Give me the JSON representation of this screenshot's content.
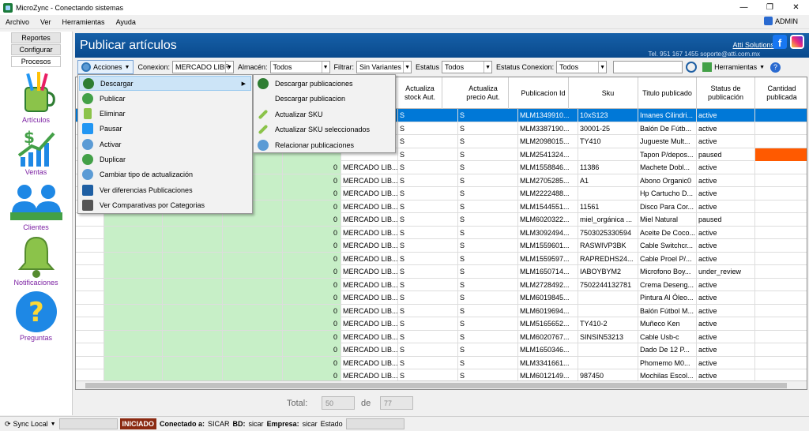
{
  "window": {
    "title": "MicroZync - Conectando sistemas"
  },
  "menubar": {
    "items": [
      "Archivo",
      "Ver",
      "Herramientas",
      "Ayuda"
    ],
    "user": "ADMIN"
  },
  "sidebar": {
    "tabs": [
      "Reportes",
      "Configurar",
      "Procesos"
    ],
    "items": [
      {
        "label": "Artículos",
        "icon": "articles-icon"
      },
      {
        "label": "Ventas",
        "icon": "sales-chart-icon"
      },
      {
        "label": "Clientes",
        "icon": "clients-icon"
      },
      {
        "label": "Notificaciones",
        "icon": "bell-icon"
      },
      {
        "label": "Preguntas",
        "icon": "question-icon"
      }
    ]
  },
  "header": {
    "title": "Publicar artículos",
    "company": "Atti Solutions",
    "contact": "Tel. 951 167 1455 soporte@atti.com.mx"
  },
  "toolbar": {
    "acciones": "Acciones",
    "conexion_label": "Conexion:",
    "conexion_value": "MERCADO LIBR",
    "almacen_label": "Almacén:",
    "almacen_value": "Todos",
    "filtrar_label": "Filtrar:",
    "filtrar_value": "Sin Variantes",
    "estatus_label": "Estatus",
    "estatus_value": "Todos",
    "estatus_conexion_label": "Estatus Conexion:",
    "estatus_conexion_value": "Todos",
    "herramientas": "Herramientas"
  },
  "menu": {
    "items": [
      "Descargar",
      "Publicar",
      "Eliminar",
      "Pausar",
      "Activar",
      "Duplicar",
      "Cambiar tipo de actualización",
      "Ver diferencias Publicaciones",
      "Ver Comparativas por Categorias"
    ],
    "submenu": [
      "Descargar publicaciones",
      "Descargar publicacion",
      "Actualizar SKU",
      "Actualizar SKU seleccionados",
      "Relacionar publicaciones"
    ]
  },
  "table": {
    "headers": [
      "Actualiza stock Aut.",
      "Actualiza precio Aut.",
      "Publicacion Id",
      "Sku",
      "Titulo publicado",
      "Status de publicación",
      "Cantidad publicada"
    ],
    "rows": [
      {
        "n": "",
        "conn": "",
        "s1": "S",
        "s2": "S",
        "id": "MLM1349910...",
        "sku": "10xS123",
        "title": "Imanes Cilindri...",
        "status": "active"
      },
      {
        "n": "",
        "conn": "",
        "s1": "S",
        "s2": "S",
        "id": "MLM3387190...",
        "sku": "30001-25",
        "title": "Balón De Fútb...",
        "status": "active"
      },
      {
        "n": "",
        "conn": "",
        "s1": "S",
        "s2": "S",
        "id": "MLM2098015...",
        "sku": "TY410",
        "title": "Jugueste Mult...",
        "status": "active"
      },
      {
        "n": "",
        "conn": "",
        "s1": "S",
        "s2": "S",
        "id": "MLM2541324...",
        "sku": "",
        "title": "Tapon P/depos...",
        "status": "paused"
      },
      {
        "n": "0",
        "conn": "MERCADO LIB...",
        "s1": "S",
        "s2": "S",
        "id": "MLM1558846...",
        "sku": "11386",
        "title": "Machete Dobl...",
        "status": "active"
      },
      {
        "n": "0",
        "conn": "MERCADO LIB...",
        "s1": "S",
        "s2": "S",
        "id": "MLM2705285...",
        "sku": "A1",
        "title": "Abono Organic0",
        "status": "active"
      },
      {
        "n": "0",
        "conn": "MERCADO LIB...",
        "s1": "S",
        "s2": "S",
        "id": "MLM2222488...",
        "sku": "",
        "title": "Hp Cartucho D...",
        "status": "active"
      },
      {
        "n": "0",
        "conn": "MERCADO LIB...",
        "s1": "S",
        "s2": "S",
        "id": "MLM1544551...",
        "sku": "11561",
        "title": "Disco Para Cor...",
        "status": "active"
      },
      {
        "n": "0",
        "conn": "MERCADO LIB...",
        "s1": "S",
        "s2": "S",
        "id": "MLM6020322...",
        "sku": "miel_orgánica ...",
        "title": "Miel Natural",
        "status": "paused"
      },
      {
        "n": "0",
        "conn": "MERCADO LIB...",
        "s1": "S",
        "s2": "S",
        "id": "MLM3092494...",
        "sku": "7503025330594",
        "title": "Aceite De Coco...",
        "status": "active"
      },
      {
        "n": "0",
        "conn": "MERCADO LIB...",
        "s1": "S",
        "s2": "S",
        "id": "MLM1559601...",
        "sku": "RASWIVP3BK",
        "title": "Cable Switchcr...",
        "status": "active"
      },
      {
        "n": "0",
        "conn": "MERCADO LIB...",
        "s1": "S",
        "s2": "S",
        "id": "MLM1559597...",
        "sku": "RAPREDHS24...",
        "title": "Cable Proel P/...",
        "status": "active"
      },
      {
        "n": "0",
        "conn": "MERCADO LIB...",
        "s1": "S",
        "s2": "S",
        "id": "MLM1650714...",
        "sku": "IABOYBYM2",
        "title": "Microfono Boy...",
        "status": "under_review"
      },
      {
        "n": "0",
        "conn": "MERCADO LIB...",
        "s1": "S",
        "s2": "S",
        "id": "MLM2728492...",
        "sku": "7502244132781",
        "title": "Crema Deseng...",
        "status": "active"
      },
      {
        "n": "0",
        "conn": "MERCADO LIB...",
        "s1": "S",
        "s2": "S",
        "id": "MLM6019845...",
        "sku": "",
        "title": "Pintura Al Óleo...",
        "status": "active"
      },
      {
        "n": "0",
        "conn": "MERCADO LIB...",
        "s1": "S",
        "s2": "S",
        "id": "MLM6019694...",
        "sku": "",
        "title": "Balón Fútbol M...",
        "status": "active"
      },
      {
        "n": "0",
        "conn": "MERCADO LIB...",
        "s1": "S",
        "s2": "S",
        "id": "MLM5165652...",
        "sku": "TY410-2",
        "title": "Muñeco Ken",
        "status": "active"
      },
      {
        "n": "0",
        "conn": "MERCADO LIB...",
        "s1": "S",
        "s2": "S",
        "id": "MLM6020767...",
        "sku": "SINSIN53213",
        "title": "Cable Usb-c",
        "status": "active"
      },
      {
        "n": "0",
        "conn": "MERCADO LIB...",
        "s1": "S",
        "s2": "S",
        "id": "MLM1650346...",
        "sku": "",
        "title": "Dado De 12 P...",
        "status": "active"
      },
      {
        "n": "0",
        "conn": "MERCADO LIB...",
        "s1": "S",
        "s2": "S",
        "id": "MLM3341661...",
        "sku": "",
        "title": "Phomemo M0...",
        "status": "active"
      },
      {
        "n": "0",
        "conn": "MERCADO LIB...",
        "s1": "S",
        "s2": "S",
        "id": "MLM6012149...",
        "sku": "987450",
        "title": "Mochilas Escol...",
        "status": "active"
      }
    ]
  },
  "footer": {
    "total_label": "Total:",
    "shown": "50",
    "de_label": "de",
    "total": "77"
  },
  "status": {
    "sync": "Sync Local",
    "iniciado": "INICIADO",
    "conectado_label": "Conectado a:",
    "conectado": "SICAR",
    "bd_label": "BD:",
    "bd": "sicar",
    "empresa_label": "Empresa:",
    "empresa": "sicar",
    "estado_label": "Estado"
  }
}
